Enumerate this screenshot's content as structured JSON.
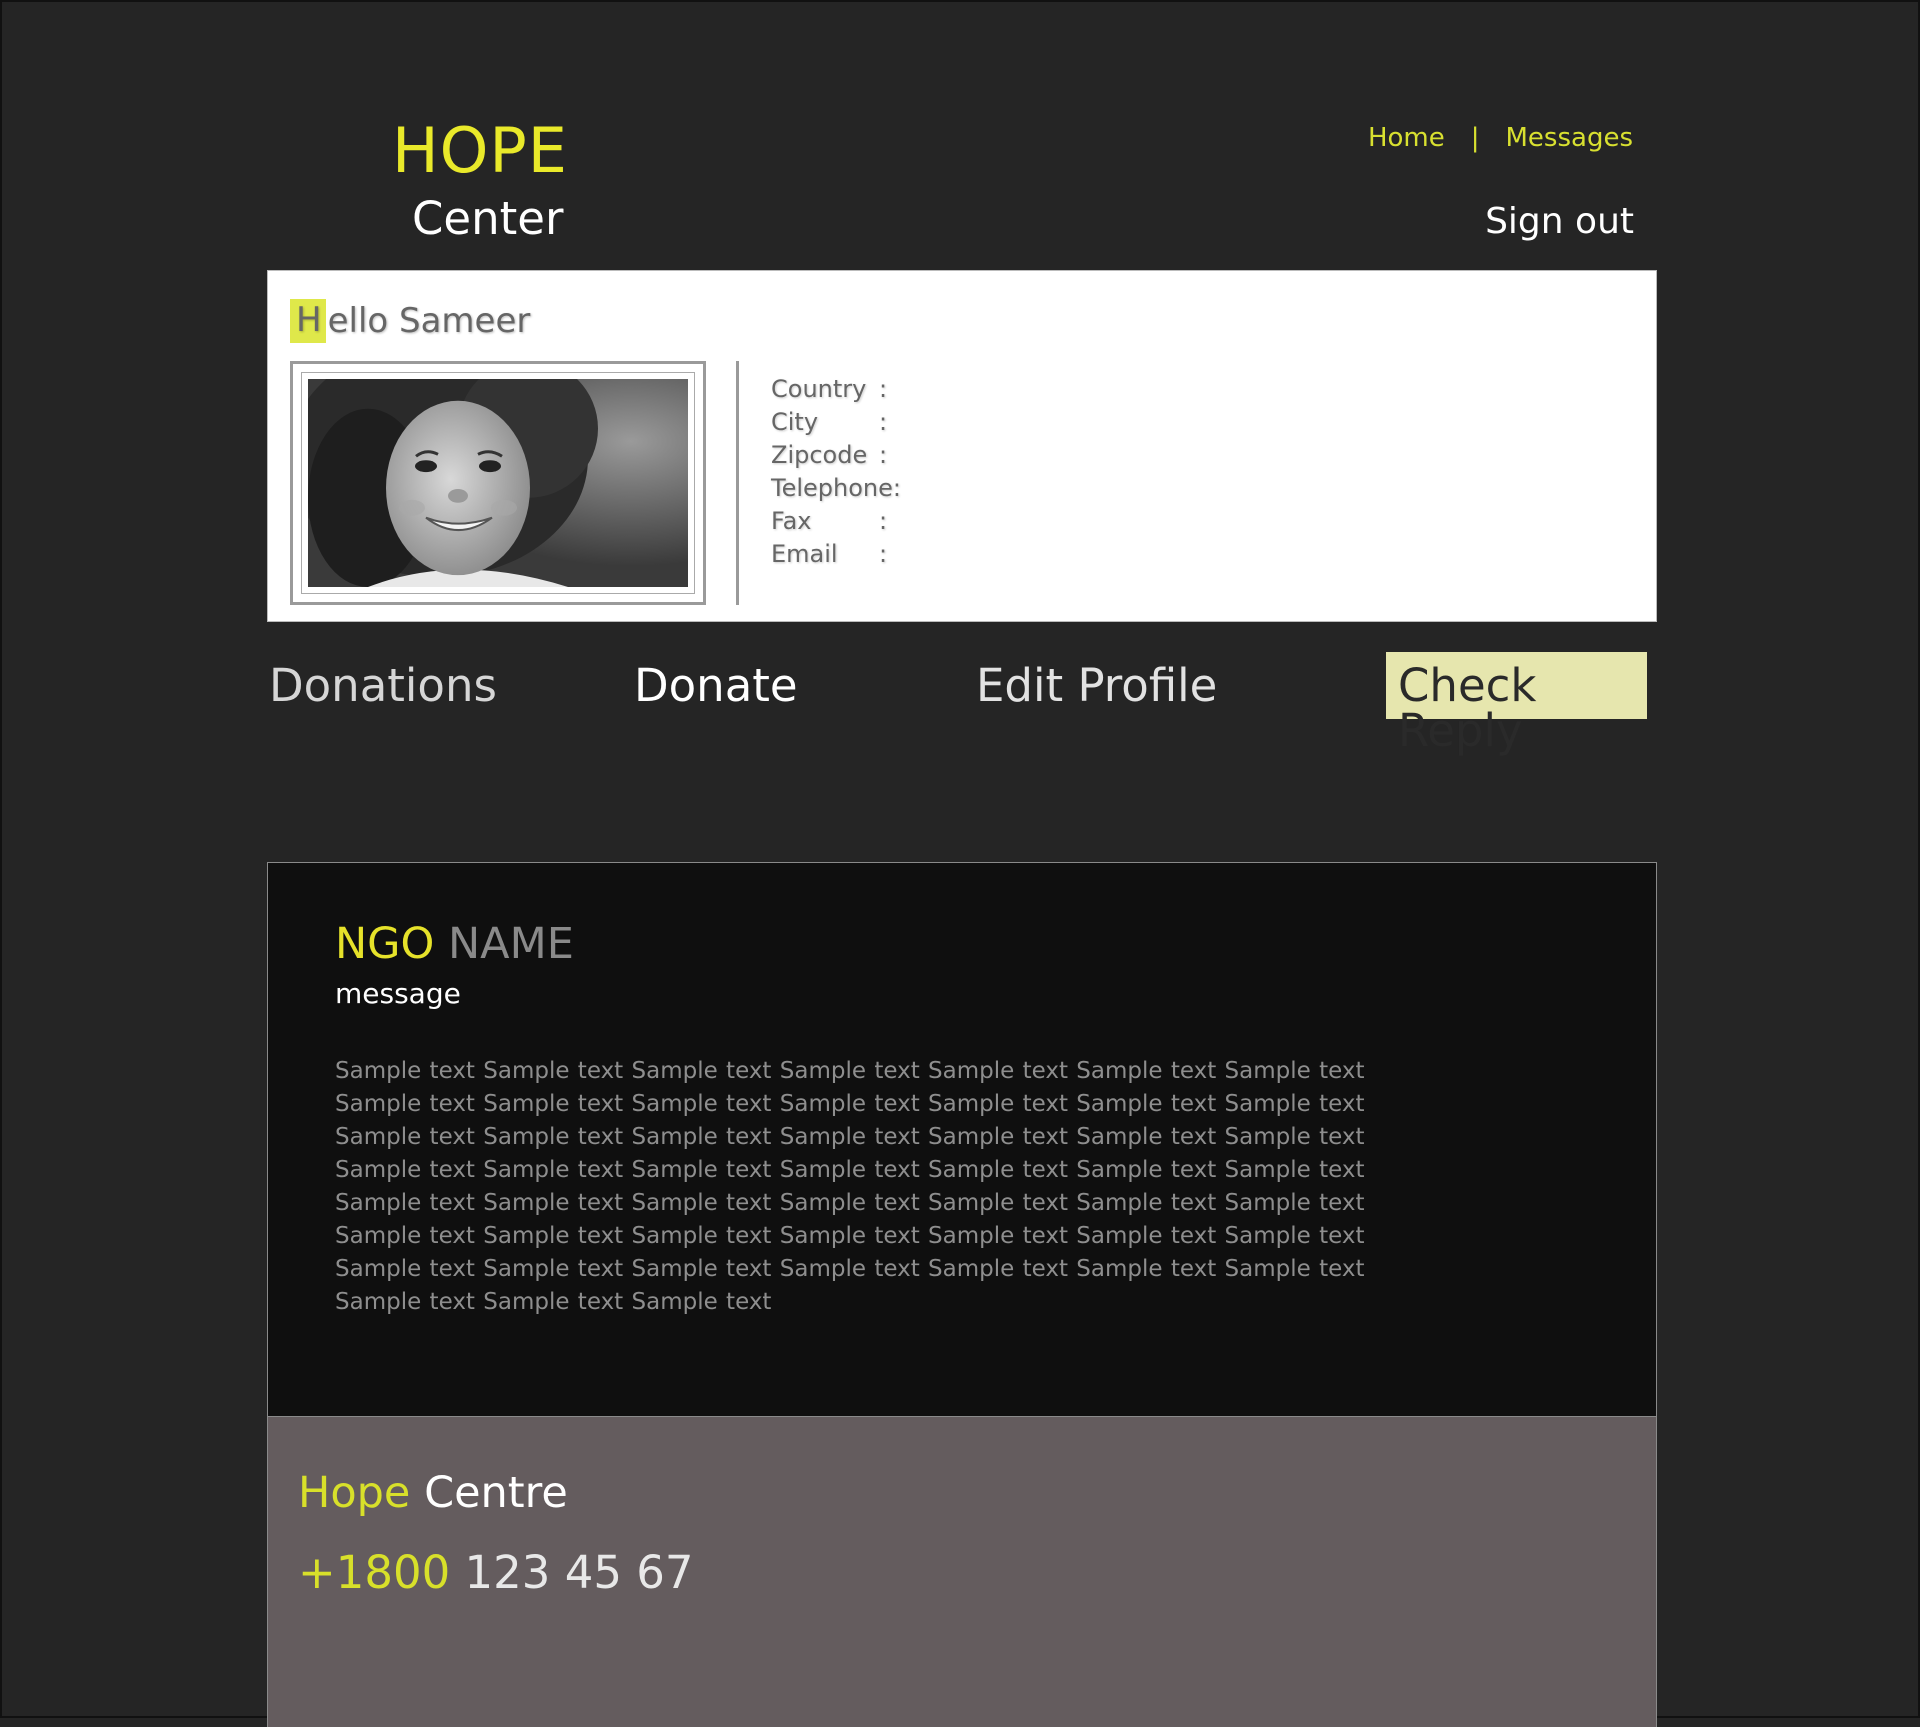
{
  "colors": {
    "background": "#252525",
    "accent_yellow": "#e9e92a",
    "check_reply_bg": "#e6e6ae",
    "footer_bg": "#645c5e",
    "message_bg": "#0f0f0f"
  },
  "header": {
    "logo_top": "HOPE",
    "logo_bottom": "Center",
    "nav": {
      "home": "Home",
      "separator": "|",
      "messages": "Messages"
    },
    "signout": "Sign out"
  },
  "profile": {
    "greeting_initial": "H",
    "greeting_rest": "ello Sameer",
    "photo_icon": "child-portrait-photo",
    "fields": [
      {
        "label": "Country",
        "sep": ":"
      },
      {
        "label": "City",
        "sep": ":"
      },
      {
        "label": "Zipcode",
        "sep": ":"
      },
      {
        "label": "Telephone",
        "sep": ":"
      },
      {
        "label": "Fax",
        "sep": ":"
      },
      {
        "label": "Email",
        "sep": ":"
      }
    ]
  },
  "menu": {
    "donations": "Donations",
    "donate": "Donate",
    "edit_profile": "Edit Profile",
    "check_reply": "Check Reply"
  },
  "message": {
    "ngo_part1": "NGO",
    "ngo_part2": " NAME",
    "label": "message",
    "body": "Sample text Sample text  Sample text Sample text Sample text Sample text Sample text  Sample text Sample text Sample text Sample text Sample text  Sample text Sample text Sample text Sample text Sample text  Sample text Sample text Sample text Sample text Sample text  Sample text Sample text Sample text Sample text Sample text  Sample text Sample text Sample text Sample text Sample text Sample text Sample text Sample text Sample text Sample text  Sample text Sample text Sample text Sample text Sample text  Sample text Sample text Sample text Sample text Sample text  Sample text Sample text Sample text Sample text Sample text"
  },
  "footer": {
    "name_part1": "Hope",
    "name_part2": " Centre",
    "phone_part1": "+1800",
    "phone_part2": " 123 45 67"
  }
}
